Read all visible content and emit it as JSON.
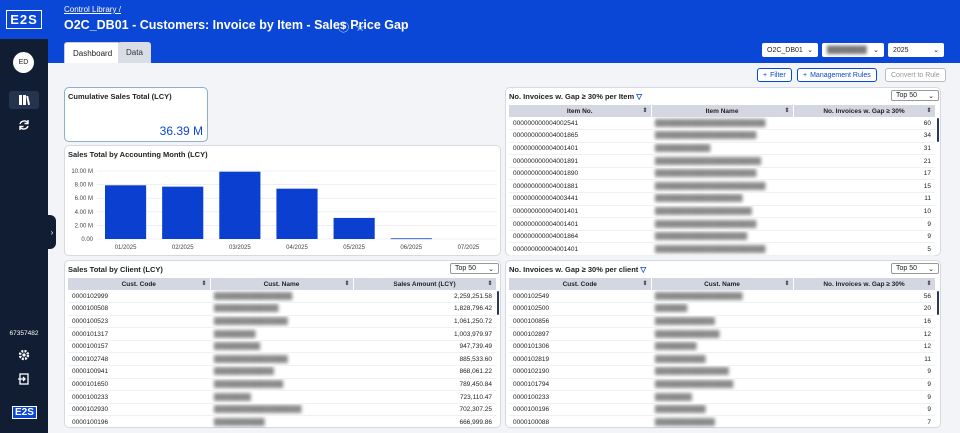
{
  "sidebar": {
    "logo": "E2S",
    "avatar": "ED",
    "user_id": "67357482",
    "bottom_logo": "E2S"
  },
  "header": {
    "breadcrumb": "Control Library /",
    "title": "O2C_DB01 - Customers: Invoice by Item - Sales Price Gap",
    "tabs": [
      "Dashboard",
      "Data"
    ],
    "selectors": [
      "O2C_DB01",
      "████████",
      "2025"
    ]
  },
  "toolbar": {
    "filter": "Filter",
    "management_rules": "Management Rules",
    "convert": "Convert to Rule"
  },
  "kpi": {
    "title": "Cumulative Sales Total (LCY)",
    "value": "36.39 M"
  },
  "chart_data": {
    "type": "bar",
    "title": "Sales Total by Accounting Month (LCY)",
    "categories": [
      "01/2025",
      "02/2025",
      "03/2025",
      "04/2025",
      "05/2025",
      "06/2025",
      "07/2025"
    ],
    "values": [
      7.9,
      7.7,
      9.9,
      7.4,
      3.1,
      0.1,
      0
    ],
    "yticks": [
      "0.00",
      "2.00 M",
      "4.00 M",
      "6.00 M",
      "8.00 M",
      "10.00 M"
    ],
    "ylim": [
      0,
      10
    ],
    "bar_color": "#0b3fd0"
  },
  "clients": {
    "title": "Sales Total by Client (LCY)",
    "top": "Top 50",
    "columns": [
      "Cust. Code",
      "Cust. Name",
      "Sales Amount (LCY)"
    ],
    "rows": [
      [
        "0000102999",
        "█████████████████",
        "2,259,251.58"
      ],
      [
        "0000100508",
        "██████████████",
        "1,828,796.42"
      ],
      [
        "0000100523",
        "████████████████",
        "1,061,250.72"
      ],
      [
        "0000101317",
        "█████████",
        "1,003,979.97"
      ],
      [
        "0000100157",
        "██████████",
        "947,739.49"
      ],
      [
        "0000102748",
        "████████████████",
        "885,533.60"
      ],
      [
        "0000100941",
        "█████████████",
        "868,061.22"
      ],
      [
        "0000101650",
        "███████████████",
        "789,450.84"
      ],
      [
        "0000100233",
        "████████",
        "723,110.47"
      ],
      [
        "0000102930",
        "███████████████████",
        "702,307.25"
      ],
      [
        "0000100196",
        "███████████",
        "666,999.86"
      ]
    ]
  },
  "items": {
    "title": "No. Invoices w. Gap ≥ 30% per Item",
    "top": "Top 50",
    "columns": [
      "Item No.",
      "Item Name",
      "No. Invoices w. Gap ≥ 30%"
    ],
    "rows": [
      [
        "000000000004002541",
        "████████████████████████",
        "60"
      ],
      [
        "000000000004001865",
        "██████████████████████",
        "34"
      ],
      [
        "000000000004001401",
        "████████████",
        "31"
      ],
      [
        "000000000004001891",
        "███████████████████████",
        "21"
      ],
      [
        "000000000004001890",
        "██████████████████████",
        "17"
      ],
      [
        "000000000004001881",
        "████████████████████████",
        "15"
      ],
      [
        "000000000004003441",
        "███████████████████",
        "11"
      ],
      [
        "000000000004001401",
        "█████████████████████",
        "10"
      ],
      [
        "000000000004001401",
        "██████████████████████",
        "9"
      ],
      [
        "000000000004001864",
        "████████████████████",
        "9"
      ],
      [
        "000000000004001401",
        "████████████████████████",
        "5"
      ]
    ]
  },
  "gap_clients": {
    "title": "No. Invoices w. Gap ≥ 30% per client",
    "top": "Top 50",
    "columns": [
      "Cust. Code",
      "Cust. Name",
      "No. Invoices w. Gap ≥ 30%"
    ],
    "rows": [
      [
        "0000102549",
        "███████████████████",
        "56"
      ],
      [
        "0000102500",
        "███████",
        "20"
      ],
      [
        "0000100856",
        "█████████████",
        "16"
      ],
      [
        "0000102897",
        "██████████████",
        "12"
      ],
      [
        "0000101306",
        "█████████",
        "12"
      ],
      [
        "0000102819",
        "███████████",
        "11"
      ],
      [
        "0000102190",
        "████████████████",
        "9"
      ],
      [
        "0000101794",
        "█████████████████",
        "9"
      ],
      [
        "0000100233",
        "████████",
        "9"
      ],
      [
        "0000100196",
        "███████████",
        "9"
      ],
      [
        "0000100088",
        "█████████████",
        "7"
      ]
    ]
  }
}
